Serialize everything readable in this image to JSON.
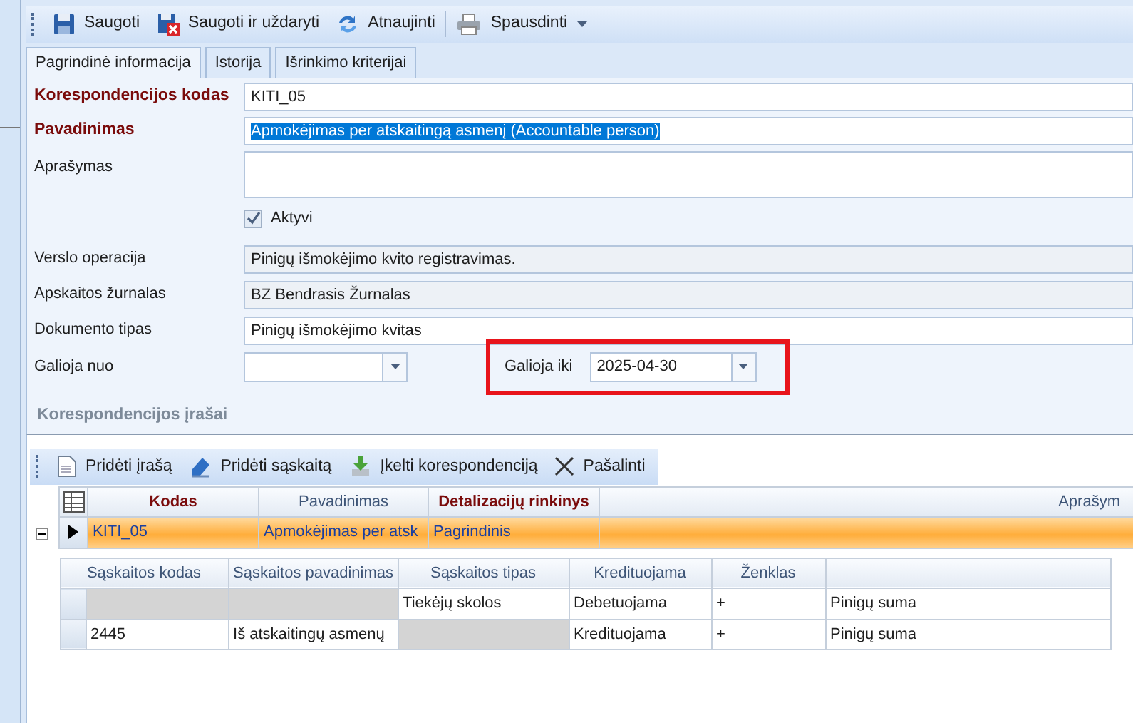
{
  "toolbar": [
    {
      "label": "Saugoti",
      "kind": "save"
    },
    {
      "label": "Saugoti ir uždaryti",
      "kind": "save-close"
    },
    {
      "label": "Atnaujinti",
      "kind": "refresh"
    },
    {
      "label": "Spausdinti",
      "kind": "print",
      "dropdown": true
    }
  ],
  "tabs": [
    {
      "label": "Pagrindinė informacija",
      "selected": true
    },
    {
      "label": "Istorija",
      "selected": false
    },
    {
      "label": "Išrinkimo kriterijai",
      "selected": false
    }
  ],
  "form": {
    "fields": [
      {
        "kind": "text",
        "label": "Korespondencijos kodas",
        "required": true,
        "value": "KITI_05"
      },
      {
        "kind": "text",
        "label": "Pavadinimas",
        "required": true,
        "value": "Apmokėjimas per atskaitingą asmenį (Accountable person)",
        "text_selected": true
      },
      {
        "kind": "memo",
        "label": "Aprašymas",
        "required": false
      },
      {
        "kind": "checkbox",
        "label": "Aktyvi",
        "checked": true
      },
      {
        "kind": "text",
        "label": "Verslo operacija",
        "required": false,
        "value": "Pinigų išmokėjimo kvito registravimas.",
        "readonly": true
      },
      {
        "kind": "text",
        "label": "Apskaitos žurnalas",
        "required": false,
        "value": "BZ Bendrasis Žurnalas",
        "readonly": true
      },
      {
        "kind": "text",
        "label": "Dokumento tipas",
        "required": false,
        "value": "Pinigų išmokėjimo kvitas",
        "readonly": false
      }
    ],
    "dates": [
      {
        "label": "Galioja nuo",
        "highlighted": false
      },
      {
        "label": "Galioja iki",
        "value": "2025-04-30",
        "highlighted": true
      }
    ]
  },
  "section_title": "Korespondencijos įrašai",
  "grid_toolbar": [
    {
      "label": "Pridėti įrašą",
      "kind": "document"
    },
    {
      "label": "Pridėti sąskaitą",
      "kind": "book"
    },
    {
      "label": "Įkelti korespondenciją",
      "kind": "import"
    },
    {
      "label": "Pašalinti",
      "kind": "delete"
    }
  ],
  "grid": {
    "columns": [
      {
        "label": "Kodas",
        "required": true
      },
      {
        "label": "Pavadinimas",
        "required": false
      },
      {
        "label": "Detalizacijų rinkinys",
        "required": true
      },
      {
        "label": "Aprašym",
        "required": false
      }
    ],
    "rows": [
      {
        "selected": true,
        "expanded": true,
        "cells": [
          "KITI_05",
          "Apmokėjimas per atsk",
          "Pagrindinis"
        ],
        "detail": {
          "columns": [
            "Sąskaitos kodas",
            "Sąskaitos pavadinimas",
            "Sąskaitos tipas",
            "Kredituojama",
            "Ženklas"
          ],
          "rows": [
            {
              "cells": [
                {
                  "disabled": true
                },
                {
                  "disabled": true
                },
                {
                  "text": "Tiekėjų skolos"
                },
                {
                  "text": "Debetuojama"
                },
                {
                  "text": "+"
                },
                {
                  "text": "Pinigų suma"
                }
              ]
            },
            {
              "cells": [
                {
                  "text": "2445"
                },
                {
                  "text": "Iš atskaitingų asmenų"
                },
                {
                  "disabled": true
                },
                {
                  "text": "Kredituojama"
                },
                {
                  "text": "+"
                },
                {
                  "text": "Pinigų suma"
                }
              ]
            }
          ]
        }
      }
    ]
  }
}
